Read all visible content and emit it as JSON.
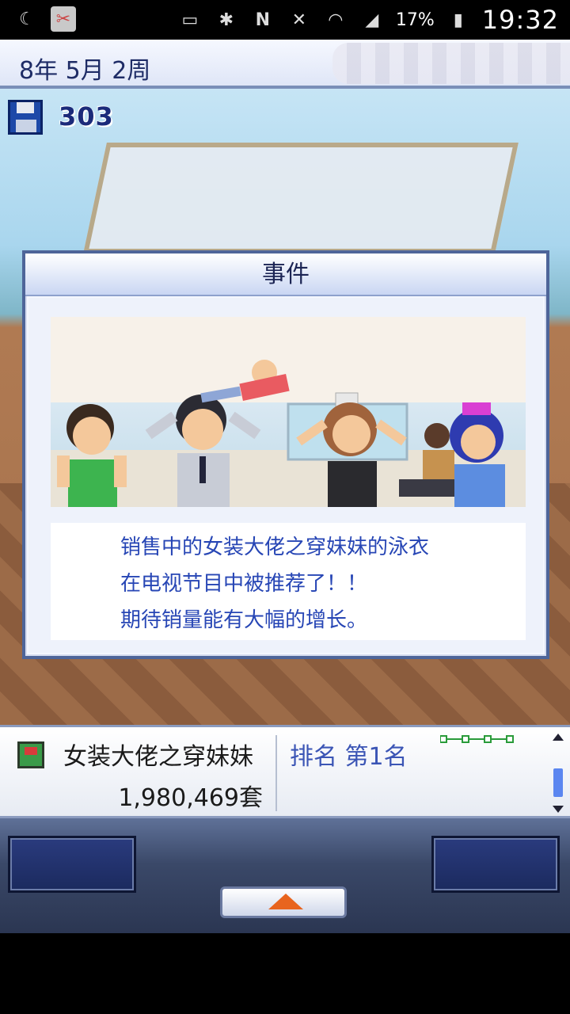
{
  "status_bar": {
    "battery_percent": "17%",
    "time": "19:32",
    "icons": [
      "moon-icon",
      "clipboard-icon",
      "cast-icon",
      "bluetooth-icon",
      "nfc-icon",
      "mute-icon",
      "wifi-icon",
      "signal-icon",
      "battery-icon"
    ]
  },
  "game": {
    "date": "8年 5月 2周",
    "money": "303"
  },
  "event_dialog": {
    "title": "事件",
    "message_lines": [
      "销售中的女装大佬之穿妹妹的泳衣",
      "在电视节目中被推荐了！！",
      "期待销量能有大幅的增长。"
    ]
  },
  "info_bar": {
    "game_name": "女装大佬之穿妹妹",
    "sales": "1,980,469套",
    "rank": "排名 第1名"
  },
  "colors": {
    "dialog_border": "#4e6599",
    "message_text": "#2746b5",
    "rank_text": "#3b55b5",
    "up_arrow": "#e8641e"
  }
}
